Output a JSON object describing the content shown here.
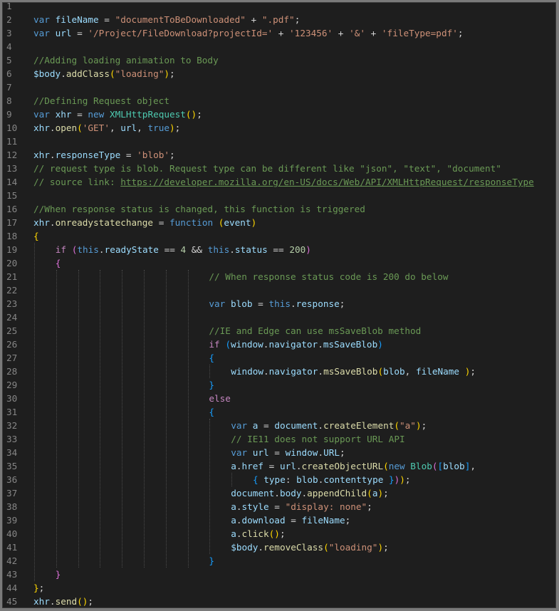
{
  "editor": {
    "colors": {
      "background": "#1e1e1e",
      "keyword": "#569cd6",
      "control": "#c586c0",
      "variable": "#9cdcfe",
      "function": "#dcdcaa",
      "string": "#ce9178",
      "number": "#b5cea8",
      "comment": "#6a9955",
      "class": "#4ec9b0",
      "bracket_1": "#ffd700",
      "bracket_2": "#da70d6",
      "bracket_3": "#179fff"
    },
    "lines": [
      {
        "n": "1",
        "indent": 0,
        "tokens": []
      },
      {
        "n": "2",
        "indent": 0,
        "tokens": [
          [
            "kw",
            "var"
          ],
          [
            "pl",
            " "
          ],
          [
            "var",
            "fileName"
          ],
          [
            "pl",
            " = "
          ],
          [
            "str",
            "\"documentToBeDownloaded\""
          ],
          [
            "pl",
            " + "
          ],
          [
            "str",
            "\".pdf\""
          ],
          [
            "pl",
            ";"
          ]
        ]
      },
      {
        "n": "3",
        "indent": 0,
        "tokens": [
          [
            "kw",
            "var"
          ],
          [
            "pl",
            " "
          ],
          [
            "var",
            "url"
          ],
          [
            "pl",
            " = "
          ],
          [
            "str",
            "'/Project/FileDownload?projectId='"
          ],
          [
            "pl",
            " + "
          ],
          [
            "str",
            "'123456'"
          ],
          [
            "pl",
            " + "
          ],
          [
            "str",
            "'&'"
          ],
          [
            "pl",
            " + "
          ],
          [
            "str",
            "'fileType=pdf'"
          ],
          [
            "pl",
            ";"
          ]
        ]
      },
      {
        "n": "4",
        "indent": 0,
        "tokens": []
      },
      {
        "n": "5",
        "indent": 0,
        "tokens": [
          [
            "com",
            "//Adding loading animation to Body"
          ]
        ]
      },
      {
        "n": "6",
        "indent": 0,
        "tokens": [
          [
            "var",
            "$body"
          ],
          [
            "pl",
            "."
          ],
          [
            "fn",
            "addClass"
          ],
          [
            "b1",
            "("
          ],
          [
            "str",
            "\"loading\""
          ],
          [
            "b1",
            ")"
          ],
          [
            "pl",
            ";"
          ]
        ]
      },
      {
        "n": "7",
        "indent": 0,
        "tokens": []
      },
      {
        "n": "8",
        "indent": 0,
        "tokens": [
          [
            "com",
            "//Defining Request object"
          ]
        ]
      },
      {
        "n": "9",
        "indent": 0,
        "tokens": [
          [
            "kw",
            "var"
          ],
          [
            "pl",
            " "
          ],
          [
            "var",
            "xhr"
          ],
          [
            "pl",
            " = "
          ],
          [
            "kw",
            "new"
          ],
          [
            "pl",
            " "
          ],
          [
            "cls",
            "XMLHttpRequest"
          ],
          [
            "b1",
            "()"
          ],
          [
            "pl",
            ";"
          ]
        ]
      },
      {
        "n": "10",
        "indent": 0,
        "tokens": [
          [
            "var",
            "xhr"
          ],
          [
            "pl",
            "."
          ],
          [
            "fn",
            "open"
          ],
          [
            "b1",
            "("
          ],
          [
            "str",
            "'GET'"
          ],
          [
            "pl",
            ", "
          ],
          [
            "var",
            "url"
          ],
          [
            "pl",
            ", "
          ],
          [
            "kw",
            "true"
          ],
          [
            "b1",
            ")"
          ],
          [
            "pl",
            ";"
          ]
        ]
      },
      {
        "n": "11",
        "indent": 0,
        "tokens": []
      },
      {
        "n": "12",
        "indent": 0,
        "tokens": [
          [
            "var",
            "xhr"
          ],
          [
            "pl",
            "."
          ],
          [
            "var",
            "responseType"
          ],
          [
            "pl",
            " = "
          ],
          [
            "str",
            "'blob'"
          ],
          [
            "pl",
            ";"
          ]
        ]
      },
      {
        "n": "13",
        "indent": 0,
        "tokens": [
          [
            "com",
            "// request type is blob. Request type can be different like \"json\", \"text\", \"document\""
          ]
        ]
      },
      {
        "n": "14",
        "indent": 0,
        "tokens": [
          [
            "com",
            "// source link: "
          ],
          [
            "link",
            "https://developer.mozilla.org/en-US/docs/Web/API/XMLHttpRequest/responseType"
          ]
        ]
      },
      {
        "n": "15",
        "indent": 0,
        "tokens": []
      },
      {
        "n": "16",
        "indent": 0,
        "tokens": [
          [
            "com",
            "//When response status is changed, this function is triggered"
          ]
        ]
      },
      {
        "n": "17",
        "indent": 0,
        "tokens": [
          [
            "var",
            "xhr"
          ],
          [
            "pl",
            "."
          ],
          [
            "fn",
            "onreadystatechange"
          ],
          [
            "pl",
            " = "
          ],
          [
            "kw",
            "function"
          ],
          [
            "pl",
            " "
          ],
          [
            "b1",
            "("
          ],
          [
            "var",
            "event"
          ],
          [
            "b1",
            ")"
          ]
        ]
      },
      {
        "n": "18",
        "indent": 0,
        "tokens": [
          [
            "b1",
            "{"
          ]
        ]
      },
      {
        "n": "19",
        "indent": 1,
        "tokens": [
          [
            "ctl",
            "if"
          ],
          [
            "pl",
            " "
          ],
          [
            "b2",
            "("
          ],
          [
            "kw",
            "this"
          ],
          [
            "pl",
            "."
          ],
          [
            "var",
            "readyState"
          ],
          [
            "pl",
            " == "
          ],
          [
            "num",
            "4"
          ],
          [
            "pl",
            " && "
          ],
          [
            "kw",
            "this"
          ],
          [
            "pl",
            "."
          ],
          [
            "var",
            "status"
          ],
          [
            "pl",
            " == "
          ],
          [
            "num",
            "200"
          ],
          [
            "b2",
            ")"
          ]
        ]
      },
      {
        "n": "20",
        "indent": 1,
        "tokens": [
          [
            "b2",
            "{"
          ]
        ]
      },
      {
        "n": "21",
        "indent": 8,
        "tokens": [
          [
            "com",
            "// When response status code is 200 do below"
          ]
        ]
      },
      {
        "n": "22",
        "indent": 0,
        "tokens": []
      },
      {
        "n": "23",
        "indent": 8,
        "tokens": [
          [
            "kw",
            "var"
          ],
          [
            "pl",
            " "
          ],
          [
            "var",
            "blob"
          ],
          [
            "pl",
            " = "
          ],
          [
            "kw",
            "this"
          ],
          [
            "pl",
            "."
          ],
          [
            "var",
            "response"
          ],
          [
            "pl",
            ";"
          ]
        ]
      },
      {
        "n": "24",
        "indent": 0,
        "tokens": []
      },
      {
        "n": "25",
        "indent": 8,
        "tokens": [
          [
            "com",
            "//IE and Edge can use msSaveBlob method"
          ]
        ]
      },
      {
        "n": "26",
        "indent": 8,
        "tokens": [
          [
            "ctl",
            "if"
          ],
          [
            "pl",
            " "
          ],
          [
            "b3",
            "("
          ],
          [
            "var",
            "window"
          ],
          [
            "pl",
            "."
          ],
          [
            "var",
            "navigator"
          ],
          [
            "pl",
            "."
          ],
          [
            "var",
            "msSaveBlob"
          ],
          [
            "b3",
            ")"
          ]
        ]
      },
      {
        "n": "27",
        "indent": 8,
        "tokens": [
          [
            "b3",
            "{"
          ]
        ]
      },
      {
        "n": "28",
        "indent": 9,
        "tokens": [
          [
            "var",
            "window"
          ],
          [
            "pl",
            "."
          ],
          [
            "var",
            "navigator"
          ],
          [
            "pl",
            "."
          ],
          [
            "fn",
            "msSaveBlob"
          ],
          [
            "b1",
            "("
          ],
          [
            "var",
            "blob"
          ],
          [
            "pl",
            ", "
          ],
          [
            "var",
            "fileName"
          ],
          [
            "pl",
            " "
          ],
          [
            "b1",
            ")"
          ],
          [
            "pl",
            ";"
          ]
        ]
      },
      {
        "n": "29",
        "indent": 8,
        "tokens": [
          [
            "b3",
            "}"
          ]
        ]
      },
      {
        "n": "30",
        "indent": 8,
        "tokens": [
          [
            "ctl",
            "else"
          ]
        ]
      },
      {
        "n": "31",
        "indent": 8,
        "tokens": [
          [
            "b3",
            "{"
          ]
        ]
      },
      {
        "n": "32",
        "indent": 9,
        "tokens": [
          [
            "kw",
            "var"
          ],
          [
            "pl",
            " "
          ],
          [
            "var",
            "a"
          ],
          [
            "pl",
            " = "
          ],
          [
            "var",
            "document"
          ],
          [
            "pl",
            "."
          ],
          [
            "fn",
            "createElement"
          ],
          [
            "b1",
            "("
          ],
          [
            "str",
            "\"a\""
          ],
          [
            "b1",
            ")"
          ],
          [
            "pl",
            ";"
          ]
        ]
      },
      {
        "n": "33",
        "indent": 9,
        "tokens": [
          [
            "com",
            "// IE11 does not support URL API"
          ]
        ]
      },
      {
        "n": "34",
        "indent": 9,
        "tokens": [
          [
            "kw",
            "var"
          ],
          [
            "pl",
            " "
          ],
          [
            "var",
            "url"
          ],
          [
            "pl",
            " = "
          ],
          [
            "var",
            "window"
          ],
          [
            "pl",
            "."
          ],
          [
            "var",
            "URL"
          ],
          [
            "pl",
            ";"
          ]
        ]
      },
      {
        "n": "35",
        "indent": 9,
        "tokens": [
          [
            "var",
            "a"
          ],
          [
            "pl",
            "."
          ],
          [
            "var",
            "href"
          ],
          [
            "pl",
            " = "
          ],
          [
            "var",
            "url"
          ],
          [
            "pl",
            "."
          ],
          [
            "fn",
            "createObjectURL"
          ],
          [
            "b1",
            "("
          ],
          [
            "kw",
            "new"
          ],
          [
            "pl",
            " "
          ],
          [
            "cls",
            "Blob"
          ],
          [
            "b2",
            "("
          ],
          [
            "b3",
            "["
          ],
          [
            "var",
            "blob"
          ],
          [
            "b3",
            "]"
          ],
          [
            "pl",
            ","
          ]
        ]
      },
      {
        "n": "36",
        "indent": 10,
        "tokens": [
          [
            "b3",
            "{"
          ],
          [
            "pl",
            " "
          ],
          [
            "var",
            "type"
          ],
          [
            "pl",
            ": "
          ],
          [
            "var",
            "blob"
          ],
          [
            "pl",
            "."
          ],
          [
            "var",
            "contenttype"
          ],
          [
            "pl",
            " "
          ],
          [
            "b3",
            "}"
          ],
          [
            "b2",
            ")"
          ],
          [
            "b1",
            ")"
          ],
          [
            "pl",
            ";"
          ]
        ]
      },
      {
        "n": "37",
        "indent": 9,
        "tokens": [
          [
            "var",
            "document"
          ],
          [
            "pl",
            "."
          ],
          [
            "var",
            "body"
          ],
          [
            "pl",
            "."
          ],
          [
            "fn",
            "appendChild"
          ],
          [
            "b1",
            "("
          ],
          [
            "var",
            "a"
          ],
          [
            "b1",
            ")"
          ],
          [
            "pl",
            ";"
          ]
        ]
      },
      {
        "n": "38",
        "indent": 9,
        "tokens": [
          [
            "var",
            "a"
          ],
          [
            "pl",
            "."
          ],
          [
            "var",
            "style"
          ],
          [
            "pl",
            " = "
          ],
          [
            "str",
            "\"display: none\""
          ],
          [
            "pl",
            ";"
          ]
        ]
      },
      {
        "n": "39",
        "indent": 9,
        "tokens": [
          [
            "var",
            "a"
          ],
          [
            "pl",
            "."
          ],
          [
            "var",
            "download"
          ],
          [
            "pl",
            " = "
          ],
          [
            "var",
            "fileName"
          ],
          [
            "pl",
            ";"
          ]
        ]
      },
      {
        "n": "40",
        "indent": 9,
        "tokens": [
          [
            "var",
            "a"
          ],
          [
            "pl",
            "."
          ],
          [
            "fn",
            "click"
          ],
          [
            "b1",
            "()"
          ],
          [
            "pl",
            ";"
          ]
        ]
      },
      {
        "n": "41",
        "indent": 9,
        "tokens": [
          [
            "var",
            "$body"
          ],
          [
            "pl",
            "."
          ],
          [
            "fn",
            "removeClass"
          ],
          [
            "b1",
            "("
          ],
          [
            "str",
            "\"loading\""
          ],
          [
            "b1",
            ")"
          ],
          [
            "pl",
            ";"
          ]
        ]
      },
      {
        "n": "42",
        "indent": 8,
        "tokens": [
          [
            "b3",
            "}"
          ]
        ]
      },
      {
        "n": "43",
        "indent": 1,
        "tokens": [
          [
            "b2",
            "}"
          ]
        ]
      },
      {
        "n": "44",
        "indent": 0,
        "tokens": [
          [
            "b1",
            "}"
          ],
          [
            "pl",
            ";"
          ]
        ]
      },
      {
        "n": "45",
        "indent": 0,
        "tokens": [
          [
            "var",
            "xhr"
          ],
          [
            "pl",
            "."
          ],
          [
            "fn",
            "send"
          ],
          [
            "b1",
            "()"
          ],
          [
            "pl",
            ";"
          ]
        ]
      }
    ]
  }
}
